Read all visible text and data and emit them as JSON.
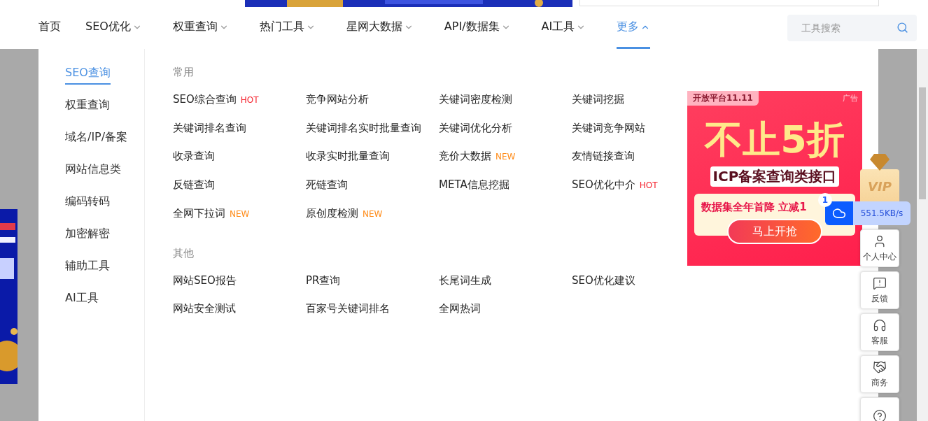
{
  "nav": {
    "items": [
      {
        "label": "首页",
        "dropdown": false,
        "selected": false
      },
      {
        "label": "SEO优化",
        "dropdown": true,
        "selected": false
      },
      {
        "label": "权重查询",
        "dropdown": true,
        "selected": false
      },
      {
        "label": "热门工具",
        "dropdown": true,
        "selected": false
      },
      {
        "label": "星网大数据",
        "dropdown": true,
        "selected": false
      },
      {
        "label": "API/数据集",
        "dropdown": true,
        "selected": false
      },
      {
        "label": "AI工具",
        "dropdown": true,
        "selected": false
      },
      {
        "label": "更多",
        "dropdown": true,
        "selected": true
      }
    ],
    "search": {
      "placeholder": "工具搜索"
    }
  },
  "sidebar": {
    "items": [
      {
        "label": "SEO查询",
        "selected": true
      },
      {
        "label": "权重查询",
        "selected": false
      },
      {
        "label": "域名/IP/备案",
        "selected": false
      },
      {
        "label": "网站信息类",
        "selected": false
      },
      {
        "label": "编码转码",
        "selected": false
      },
      {
        "label": "加密解密",
        "selected": false
      },
      {
        "label": "辅助工具",
        "selected": false
      },
      {
        "label": "AI工具",
        "selected": false
      }
    ]
  },
  "sections": [
    {
      "title": "常用",
      "items": [
        {
          "label": "SEO综合查询",
          "badge": "HOT",
          "kind": "hot"
        },
        {
          "label": "竞争网站分析"
        },
        {
          "label": "关键词密度检测"
        },
        {
          "label": "关键词挖掘"
        },
        {
          "label": "关键词排名查询"
        },
        {
          "label": "关键词排名实时批量查询"
        },
        {
          "label": "关键词优化分析"
        },
        {
          "label": "关键词竞争网站"
        },
        {
          "label": "收录查询"
        },
        {
          "label": "收录实时批量查询"
        },
        {
          "label": "竞价大数据",
          "badge": "NEW",
          "kind": "new"
        },
        {
          "label": "友情链接查询"
        },
        {
          "label": "反链查询"
        },
        {
          "label": "死链查询"
        },
        {
          "label": "META信息挖掘"
        },
        {
          "label": "SEO优化中介",
          "badge": "HOT",
          "kind": "hot"
        },
        {
          "label": "全网下拉词",
          "badge": "NEW",
          "kind": "new"
        },
        {
          "label": "原创度检测",
          "badge": "NEW",
          "kind": "new"
        }
      ]
    },
    {
      "title": "其他",
      "items": [
        {
          "label": "网站SEO报告"
        },
        {
          "label": "PR查询"
        },
        {
          "label": "长尾词生成"
        },
        {
          "label": "SEO优化建议"
        },
        {
          "label": "网站安全测试"
        },
        {
          "label": "百家号关键词排名"
        },
        {
          "label": "全网热词"
        }
      ]
    }
  ],
  "ad": {
    "tag": "开放平台11.11",
    "label": "广告",
    "headline": "不止5折",
    "subtitle": "ICP备案查询类接口",
    "offer": "数据集全年首降 立减1",
    "button": "马上开抢"
  },
  "float": {
    "vip": "VIP",
    "speed": {
      "count": "1",
      "rate": "551.5KB/s"
    },
    "buttons": [
      {
        "label": "个人中心",
        "kind": "user"
      },
      {
        "label": "反馈",
        "kind": "feedback"
      },
      {
        "label": "客服",
        "kind": "service"
      },
      {
        "label": "商务",
        "kind": "business"
      },
      {
        "kind": "help"
      }
    ]
  }
}
